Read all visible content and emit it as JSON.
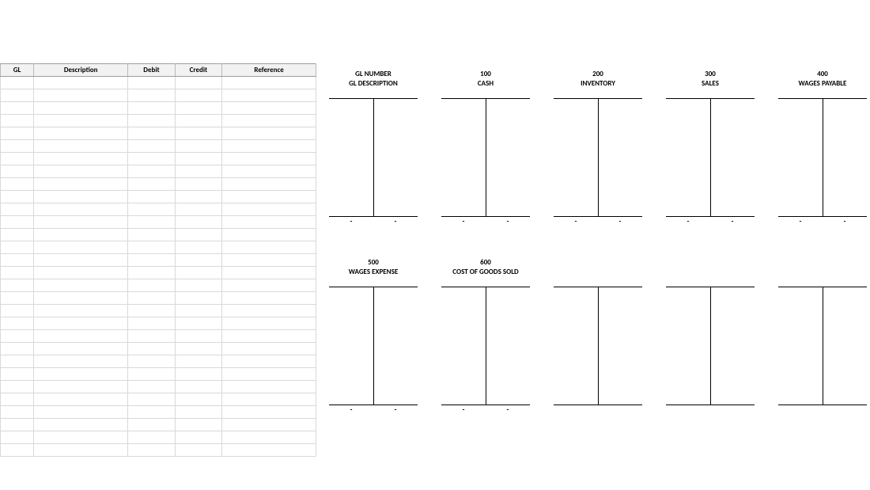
{
  "journal": {
    "headers": [
      "GL",
      "Description",
      "Debit",
      "Credit",
      "Reference"
    ],
    "blank_rows": 30
  },
  "header_labels": {
    "number": "GL NUMBER",
    "description": "GL DESCRIPTION"
  },
  "accounts_row1": [
    {
      "number": "100",
      "desc": "CASH",
      "total_left": "-",
      "total_right": "-"
    },
    {
      "number": "200",
      "desc": "INVENTORY",
      "total_left": "-",
      "total_right": "-"
    },
    {
      "number": "300",
      "desc": "SALES",
      "total_left": "-",
      "total_right": "-"
    },
    {
      "number": "400",
      "desc": "WAGES PAYABLE",
      "total_left": "-",
      "total_right": "-"
    }
  ],
  "accounts_row2": [
    {
      "number": "500",
      "desc": "WAGES EXPENSE",
      "total_left": "-",
      "total_right": "-"
    },
    {
      "number": "600",
      "desc": "COST OF GOODS SOLD",
      "total_left": "-",
      "total_right": "-"
    },
    {
      "number": "",
      "desc": "",
      "total_left": "",
      "total_right": ""
    },
    {
      "number": "",
      "desc": "",
      "total_left": "",
      "total_right": ""
    },
    {
      "number": "",
      "desc": "",
      "total_left": "",
      "total_right": ""
    }
  ]
}
